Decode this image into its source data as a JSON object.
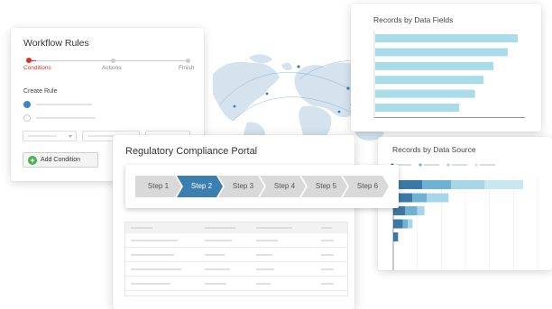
{
  "workflow": {
    "title": "Workflow Rules",
    "steps": [
      {
        "label": "Conditions",
        "active": true
      },
      {
        "label": "Actions",
        "active": false
      },
      {
        "label": "Finish",
        "active": false
      }
    ],
    "create_rule_label": "Create Rule",
    "add_condition_label": "Add Condition",
    "colors": {
      "active": "#d9322b",
      "radio": "#3a86c8",
      "add_icon": "#4caf50"
    }
  },
  "portal": {
    "title": "Regulatory Compliance Portal",
    "steps": [
      "Step 1",
      "Step 2",
      "Step 3",
      "Step 4",
      "Step 5",
      "Step 6"
    ],
    "active_step": "Step 2",
    "colors": {
      "active": "#3b7fb0",
      "inactive": "#d9d9d9"
    }
  },
  "records_by_fields": {
    "title": "Records by Data Fields",
    "chart_data": {
      "type": "bar",
      "orientation": "horizontal",
      "values": [
        100,
        93,
        83,
        76,
        70,
        59
      ],
      "color": "#a9dbe9"
    }
  },
  "records_by_source": {
    "title": "Records by Data Source",
    "chart_data": {
      "type": "bar",
      "orientation": "horizontal",
      "stacked": true,
      "series_colors": [
        "#3b78a6",
        "#6fb1d3",
        "#a7d6e8",
        "#c7e7f1"
      ],
      "series": [
        {
          "values": [
            12,
            8,
            5,
            4,
            2,
            0,
            0
          ]
        },
        {
          "values": [
            12,
            6,
            5,
            2,
            0,
            0,
            0
          ]
        },
        {
          "values": [
            14,
            9,
            3,
            2,
            0,
            0,
            0
          ]
        },
        {
          "values": [
            16,
            0,
            0,
            0,
            0,
            0,
            0
          ]
        }
      ]
    }
  }
}
